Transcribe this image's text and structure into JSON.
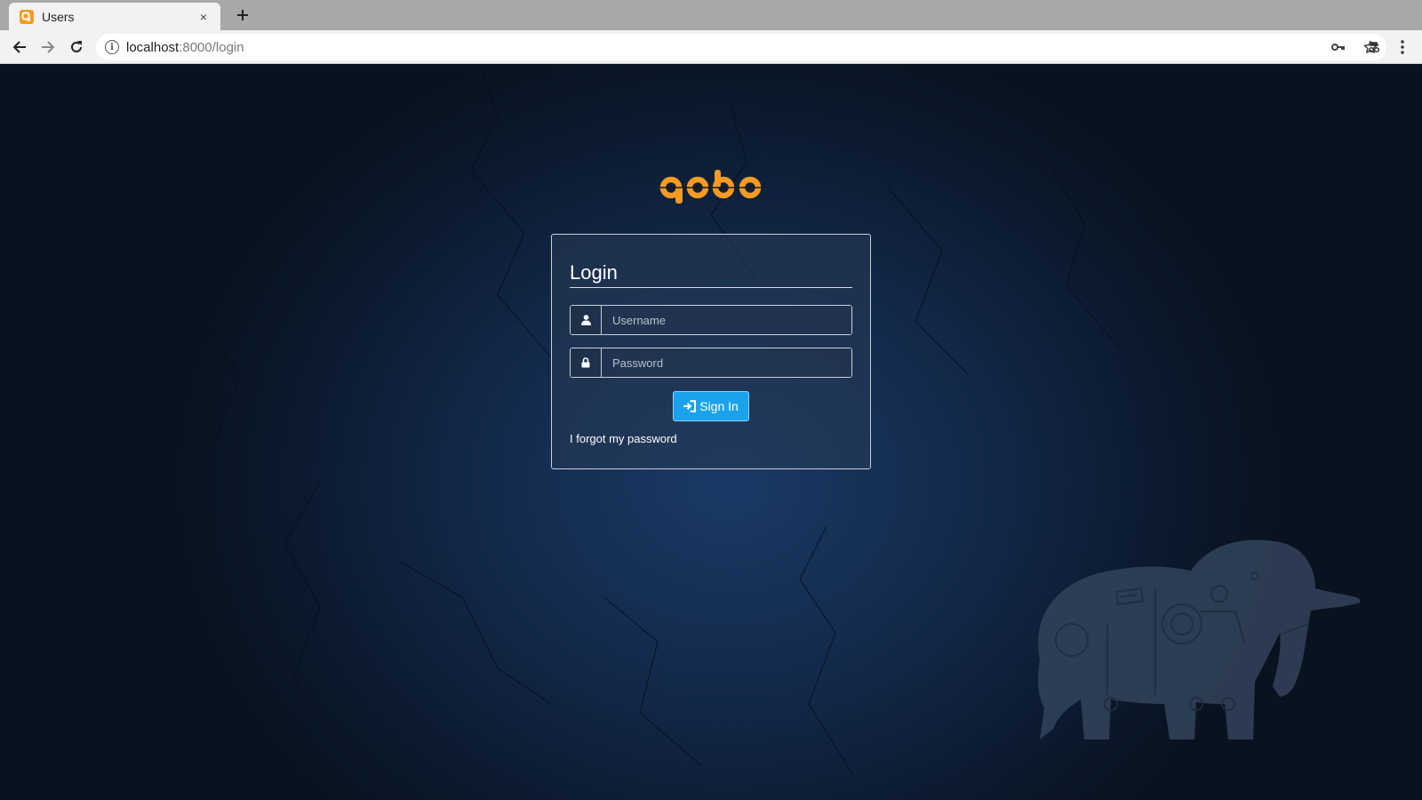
{
  "browser": {
    "tab_title": "Users",
    "tab_close": "×",
    "url_host": "localhost",
    "url_rest": ":8000/login",
    "icons": [
      "favicon-icon",
      "close-icon",
      "plus-icon",
      "back-arrow-icon",
      "forward-arrow-icon",
      "reload-icon",
      "info-icon",
      "key-icon",
      "star-icon",
      "extension-icon",
      "more-vertical-icon"
    ]
  },
  "login": {
    "title": "Login",
    "username_placeholder": "Username",
    "password_placeholder": "Password",
    "signin_label": "Sign In",
    "forgot_link": "I forgot my password"
  },
  "colors": {
    "brand_orange": "#f59a23",
    "button_blue": "#1aa3ec",
    "background_dark": "#0b1a2e"
  }
}
